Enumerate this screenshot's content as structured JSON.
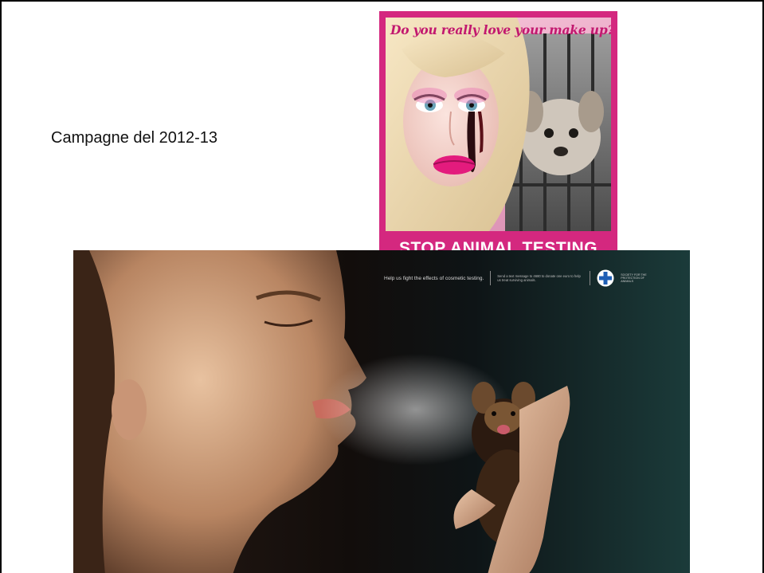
{
  "slide": {
    "caption": "Campagne del 2012-13"
  },
  "poster_pink": {
    "headline": "Do you really love your make up?",
    "footer": "STOP ANIMAL TESTING",
    "bg_color": "#d4287f"
  },
  "poster_dark": {
    "tagline": "Help us fight the effects of cosmetic testing.",
    "donation_text": "Send a text message to 4680 to donate one euro to help us treat surviving animals.",
    "org_name": "SOCIETY FOR THE PROTECTION OF ANIMALS",
    "logo_icon": "blue-cross-icon"
  }
}
